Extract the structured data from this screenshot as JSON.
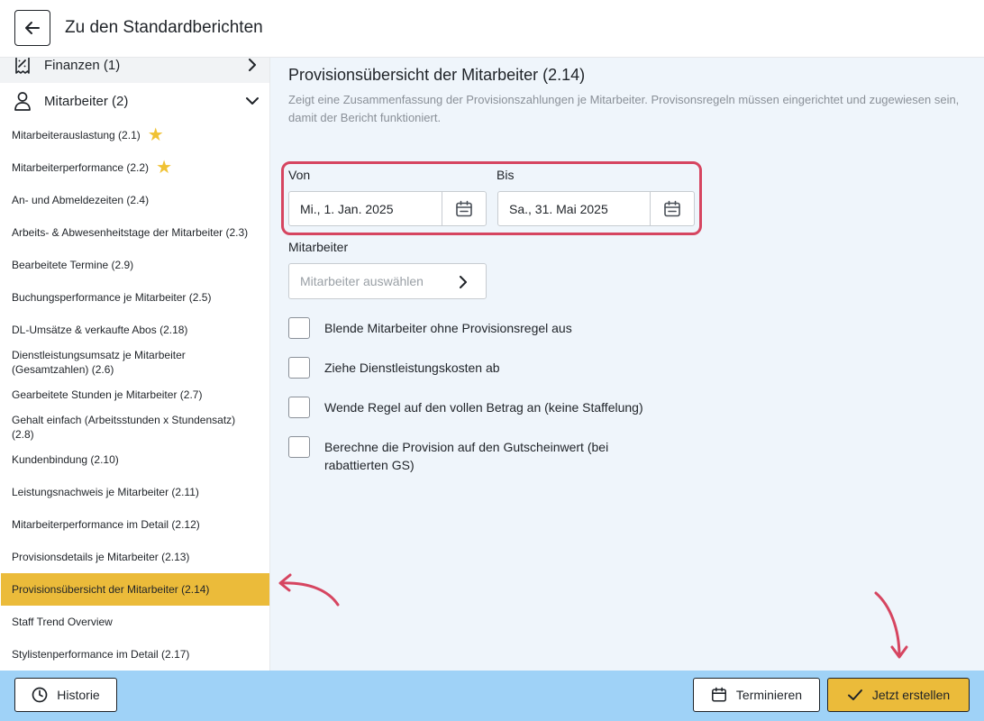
{
  "header": {
    "title": "Zu den Standardberichten"
  },
  "sidebar": {
    "categories": [
      {
        "label": "Finanzen (1)",
        "icon": "receipt-icon"
      },
      {
        "label": "Mitarbeiter (2)",
        "icon": "person-icon"
      }
    ],
    "items": [
      {
        "label": "Mitarbeiterauslastung (2.1)",
        "starred": true
      },
      {
        "label": "Mitarbeiterperformance (2.2)",
        "starred": true
      },
      {
        "label": "An- und Abmeldezeiten (2.4)"
      },
      {
        "label": "Arbeits- & Abwesenheitstage der Mitarbeiter (2.3)"
      },
      {
        "label": "Bearbeitete Termine (2.9)"
      },
      {
        "label": "Buchungsperformance je Mitarbeiter (2.5)"
      },
      {
        "label": "DL-Umsätze & verkaufte Abos (2.18)"
      },
      {
        "label": "Dienstleistungsumsatz je Mitarbeiter (Gesamtzahlen) (2.6)"
      },
      {
        "label": "Gearbeitete Stunden je Mitarbeiter (2.7)"
      },
      {
        "label": "Gehalt einfach (Arbeitsstunden x Stundensatz) (2.8)"
      },
      {
        "label": "Kundenbindung (2.10)"
      },
      {
        "label": "Leistungsnachweis je Mitarbeiter (2.11)"
      },
      {
        "label": "Mitarbeiterperformance im Detail (2.12)"
      },
      {
        "label": "Provisionsdetails je Mitarbeiter (2.13)"
      },
      {
        "label": "Provisionsübersicht der Mitarbeiter (2.14)",
        "active": true
      },
      {
        "label": "Staff Trend Overview"
      },
      {
        "label": "Stylistenperformance im Detail (2.17)"
      }
    ]
  },
  "main": {
    "title": "Provisionsübersicht der Mitarbeiter (2.14)",
    "description": "Zeigt eine Zusammenfassung der Provisionszahlungen je Mitarbeiter. Provisonsregeln müssen eingerichtet und zugewiesen sein, damit der Bericht funktioniert.",
    "from": {
      "label": "Von",
      "value": "Mi., 1. Jan. 2025"
    },
    "to": {
      "label": "Bis",
      "value": "Sa., 31. Mai 2025"
    },
    "employee": {
      "label": "Mitarbeiter",
      "placeholder": "Mitarbeiter auswählen"
    },
    "options": [
      "Blende Mitarbeiter ohne Provisionsregel aus",
      "Ziehe Dienstleistungskosten ab",
      "Wende Regel auf den vollen Betrag an (keine Staffelung)",
      "Berechne die Provision auf den Gutscheinwert (bei rabattierten GS)"
    ]
  },
  "footer": {
    "history_label": "Historie",
    "schedule_label": "Terminieren",
    "create_label": "Jetzt erstellen"
  },
  "colors": {
    "accent": "#ebbb3a",
    "highlight": "#d64560",
    "footer_bg": "#9fd2f7",
    "main_bg": "#eff5fb",
    "star": "#f0c234"
  }
}
